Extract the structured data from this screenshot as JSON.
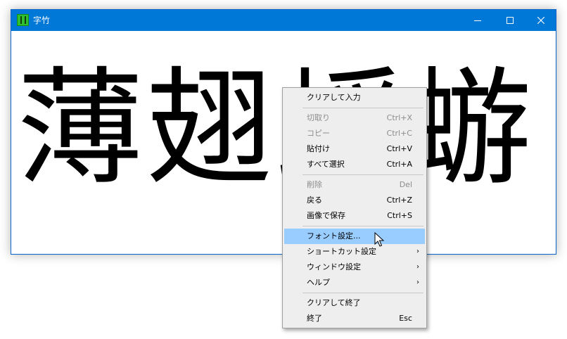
{
  "window": {
    "title": "字竹",
    "app_icon": "bamboo-app-icon",
    "controls": [
      "minimize-icon",
      "maximize-icon",
      "close-icon"
    ]
  },
  "content": {
    "text": "薄翅蜉蝣"
  },
  "context_menu": {
    "items": [
      {
        "label": "クリアして入力",
        "shortcut": "",
        "disabled": false
      },
      {
        "label": "切取り",
        "shortcut": "Ctrl+X",
        "disabled": true
      },
      {
        "label": "コピー",
        "shortcut": "Ctrl+C",
        "disabled": true
      },
      {
        "label": "貼付け",
        "shortcut": "Ctrl+V",
        "disabled": false
      },
      {
        "label": "すべて選択",
        "shortcut": "Ctrl+A",
        "disabled": false
      },
      {
        "label": "削除",
        "shortcut": "Del",
        "disabled": true
      },
      {
        "label": "戻る",
        "shortcut": "Ctrl+Z",
        "disabled": false
      },
      {
        "label": "画像で保存",
        "shortcut": "Ctrl+S",
        "disabled": false
      },
      {
        "label": "フォント設定...",
        "shortcut": "",
        "disabled": false,
        "highlighted": true
      },
      {
        "label": "ショートカット設定",
        "shortcut": "",
        "submenu": true
      },
      {
        "label": "ウィンドウ設定",
        "shortcut": "",
        "submenu": true
      },
      {
        "label": "ヘルプ",
        "shortcut": "",
        "submenu": true
      },
      {
        "label": "クリアして終了",
        "shortcut": "",
        "disabled": false
      },
      {
        "label": "終了",
        "shortcut": "Esc",
        "disabled": false
      }
    ],
    "submenu_arrow": "›"
  },
  "colors": {
    "titlebar": "#0078d7",
    "menu_background": "#eeeeee",
    "menu_highlight": "#99ccff",
    "disabled_text": "#8c8c8c"
  }
}
